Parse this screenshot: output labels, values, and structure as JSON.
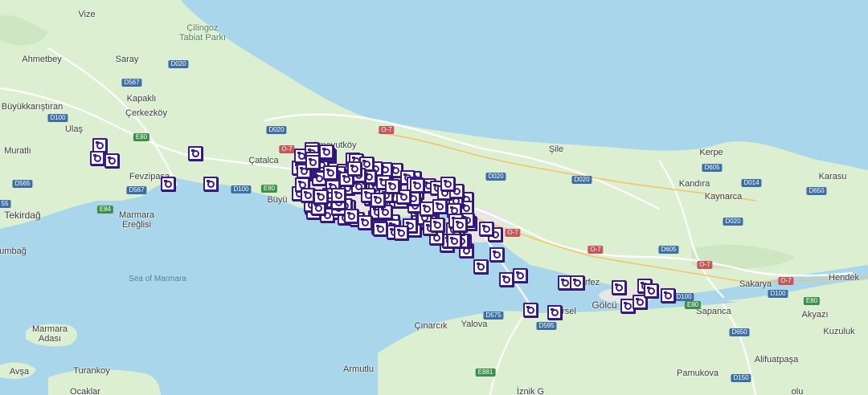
{
  "map": {
    "labels": [
      {
        "name": "label-vize",
        "text": "Vize"
      },
      {
        "name": "label-cilingoz",
        "text": "Çilingoz\nTabiat Parkı"
      },
      {
        "name": "label-ahmetbey",
        "text": "Ahmetbey"
      },
      {
        "name": "label-saray",
        "text": "Saray"
      },
      {
        "name": "label-kapakli",
        "text": "Kapaklı"
      },
      {
        "name": "label-buyukkaristiran",
        "text": "Büyükkarıştıran"
      },
      {
        "name": "label-cerkezkoy",
        "text": "Çerkezköy"
      },
      {
        "name": "label-ulas",
        "text": "Ulaş"
      },
      {
        "name": "label-muratli",
        "text": "Muratlı"
      },
      {
        "name": "label-fevzipasa",
        "text": "Fevzipaşa"
      },
      {
        "name": "label-tekirdag",
        "text": "Tekirdağ"
      },
      {
        "name": "label-marmara-ereglisi",
        "text": "Marmara\nEreğlisi"
      },
      {
        "name": "label-catalca",
        "text": "Çatalca"
      },
      {
        "name": "label-arnavutkoy",
        "text": "Arnavutköy"
      },
      {
        "name": "label-buyukcekmece",
        "text": "Büyü"
      },
      {
        "name": "label-sile",
        "text": "Şile"
      },
      {
        "name": "label-kerpe",
        "text": "Kerpe"
      },
      {
        "name": "label-kandira",
        "text": "Kandıra"
      },
      {
        "name": "label-kaynarca",
        "text": "Kaynarca"
      },
      {
        "name": "label-karasu",
        "text": "Karasu"
      },
      {
        "name": "label-sea-of-marmara",
        "text": "Sea of Marmara"
      },
      {
        "name": "label-kumbag",
        "text": "umbağ"
      },
      {
        "name": "label-marmara-adasi",
        "text": "Marmara\nAdası"
      },
      {
        "name": "label-avsa",
        "text": "Avşa"
      },
      {
        "name": "label-turankoy",
        "text": "Turankoy"
      },
      {
        "name": "label-ocaklar",
        "text": "Ocaklar"
      },
      {
        "name": "label-cinarcik",
        "text": "Çınarcık"
      },
      {
        "name": "label-yalova",
        "text": "Yalova"
      },
      {
        "name": "label-armutlu",
        "text": "Armutlu"
      },
      {
        "name": "label-korfez",
        "text": "rfez"
      },
      {
        "name": "label-altinova",
        "text": "rsel"
      },
      {
        "name": "label-golcuk",
        "text": "Gölcü"
      },
      {
        "name": "label-sapanca",
        "text": "Sapanca"
      },
      {
        "name": "label-sakarya",
        "text": "Sakarya"
      },
      {
        "name": "label-hendek",
        "text": "Hendek"
      },
      {
        "name": "label-akyazi",
        "text": "Akyazı"
      },
      {
        "name": "label-kuzuluk",
        "text": "Kuzuluk"
      },
      {
        "name": "label-alifuatpasa",
        "text": "Alifuatpaşa"
      },
      {
        "name": "label-pamukova",
        "text": "Pamukova"
      },
      {
        "name": "label-izmik",
        "text": "İznik G"
      },
      {
        "name": "label-olu",
        "text": "olu"
      }
    ],
    "shields": [
      {
        "name": "shield-d020-north",
        "text": "D020",
        "color": "blue"
      },
      {
        "name": "shield-d567-north",
        "text": "D567",
        "color": "blue"
      },
      {
        "name": "shield-d100-west",
        "text": "D100",
        "color": "blue"
      },
      {
        "name": "shield-e80-west",
        "text": "E80",
        "color": "green"
      },
      {
        "name": "shield-d567-south",
        "text": "D567",
        "color": "blue"
      },
      {
        "name": "shield-d565",
        "text": "D565",
        "color": "blue"
      },
      {
        "name": "shield-e84",
        "text": "E84",
        "color": "green"
      },
      {
        "name": "shield-d100-catalca",
        "text": "D100",
        "color": "blue"
      },
      {
        "name": "shield-e80-catalca",
        "text": "E80",
        "color": "green"
      },
      {
        "name": "shield-d020-catalca",
        "text": "D020",
        "color": "blue"
      },
      {
        "name": "shield-o7-arnavutkoy",
        "text": "O-7",
        "color": "red"
      },
      {
        "name": "shield-o7-north",
        "text": "O-7",
        "color": "red"
      },
      {
        "name": "shield-d020-east",
        "text": "D020",
        "color": "blue"
      },
      {
        "name": "shield-d020-sile",
        "text": "D020",
        "color": "blue"
      },
      {
        "name": "shield-d605-kerpe",
        "text": "D605",
        "color": "blue"
      },
      {
        "name": "shield-d014",
        "text": "D014",
        "color": "blue"
      },
      {
        "name": "shield-d650",
        "text": "D650",
        "color": "blue"
      },
      {
        "name": "shield-d020-kaynarca",
        "text": "D020",
        "color": "blue"
      },
      {
        "name": "shield-o7-east",
        "text": "O-7",
        "color": "red"
      },
      {
        "name": "shield-o7-mid",
        "text": "O-7",
        "color": "red"
      },
      {
        "name": "shield-d605-mid",
        "text": "D605",
        "color": "blue"
      },
      {
        "name": "shield-o7-sapanca",
        "text": "O-7",
        "color": "red"
      },
      {
        "name": "shield-o7-sakarya",
        "text": "O-7",
        "color": "red"
      },
      {
        "name": "shield-d100-sakarya",
        "text": "D100",
        "color": "blue"
      },
      {
        "name": "shield-e80-hendek",
        "text": "E80",
        "color": "green"
      },
      {
        "name": "shield-d100-golcuk",
        "text": "D100",
        "color": "blue"
      },
      {
        "name": "shield-e80-golcuk",
        "text": "E80",
        "color": "green"
      },
      {
        "name": "shield-d575",
        "text": "D575",
        "color": "blue"
      },
      {
        "name": "shield-d595",
        "text": "D595",
        "color": "blue"
      },
      {
        "name": "shield-d650-south",
        "text": "D650",
        "color": "blue"
      },
      {
        "name": "shield-d150",
        "text": "D150",
        "color": "blue"
      },
      {
        "name": "shield-e881",
        "text": "E881",
        "color": "green"
      },
      {
        "name": "shield-d55-west",
        "text": "55",
        "color": "blue"
      }
    ],
    "camera_count": 160,
    "colors": {
      "water": "#a9d6ea",
      "land": "#dcefd1",
      "camera_border": "#3b1a8c"
    }
  }
}
